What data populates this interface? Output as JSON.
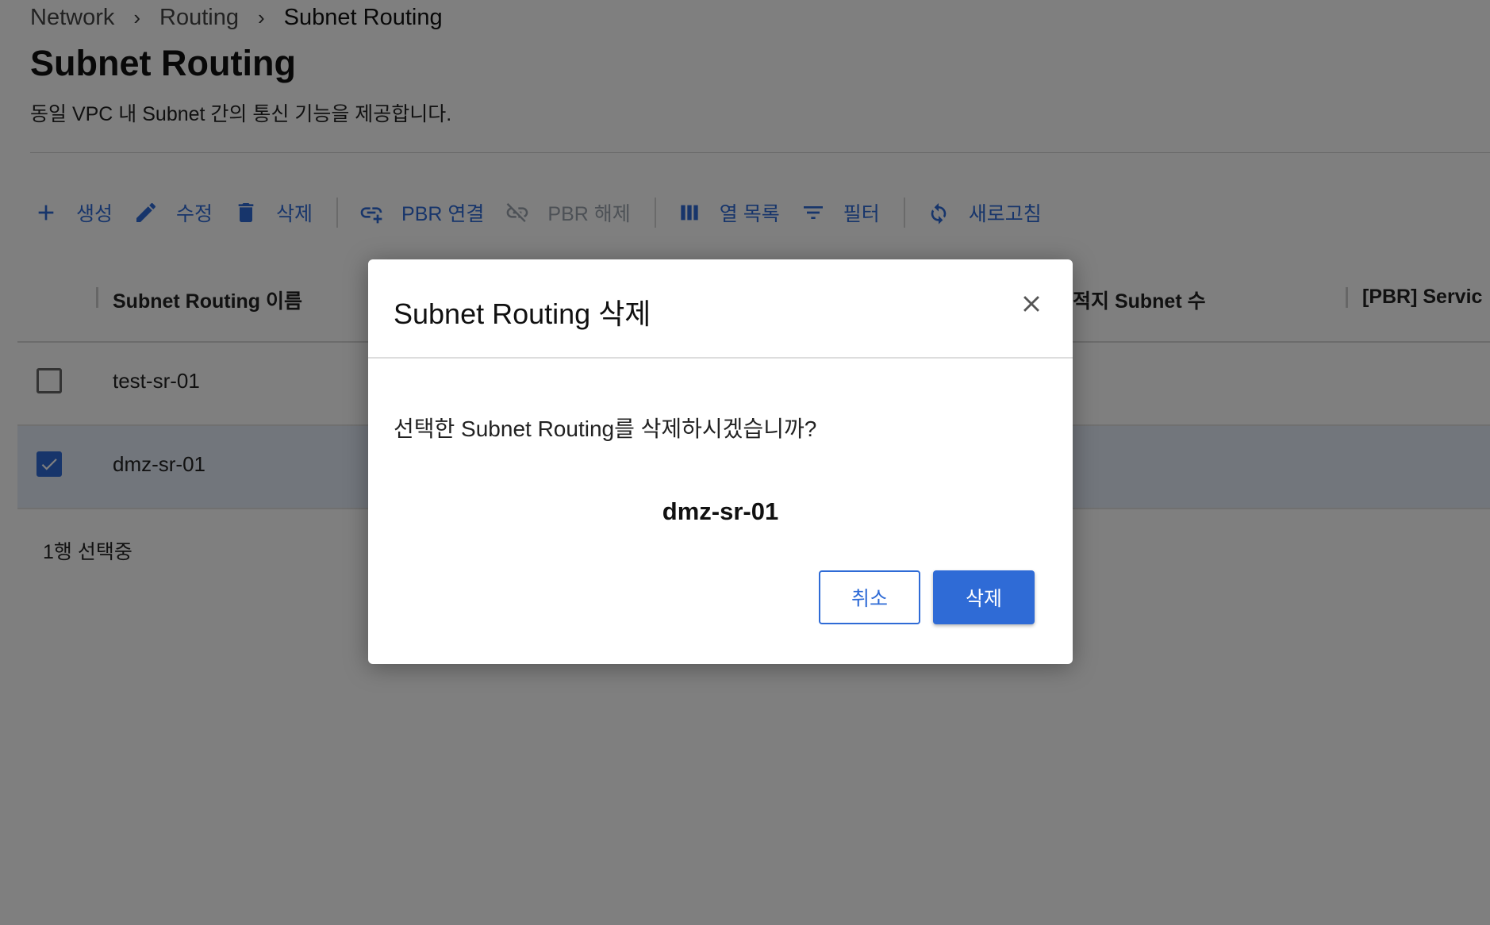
{
  "breadcrumb": [
    {
      "label": "Network"
    },
    {
      "label": "Routing"
    },
    {
      "label": "Subnet Routing"
    }
  ],
  "page": {
    "title": "Subnet Routing",
    "description": "동일 VPC 내 Subnet 간의 통신 기능을 제공합니다."
  },
  "toolbar": {
    "create": "생성",
    "edit": "수정",
    "delete": "삭제",
    "pbr_connect": "PBR 연결",
    "pbr_disconnect": "PBR 해제",
    "columns": "열 목록",
    "filter": "필터",
    "refresh": "새로고침"
  },
  "table": {
    "headers": [
      "Subnet Routing 이름",
      "적지 Subnet 수",
      "[PBR] Servic"
    ],
    "rows": [
      {
        "name": "test-sr-01",
        "checked": false
      },
      {
        "name": "dmz-sr-01",
        "checked": true
      }
    ],
    "selection_text": "1행 선택중"
  },
  "modal": {
    "title": "Subnet Routing 삭제",
    "message": "선택한 Subnet Routing를 삭제하시겠습니까?",
    "target": "dmz-sr-01",
    "cancel_label": "취소",
    "delete_label": "삭제"
  },
  "colors": {
    "accent": "#2f6bd6",
    "disabled": "#9aa3ad",
    "selected_row": "#e4ecf8",
    "overlay": "rgba(0,0,0,0.5)"
  },
  "icons": [
    "plus-icon",
    "pencil-icon",
    "trash-icon",
    "link-add-icon",
    "link-off-icon",
    "columns-icon",
    "filter-icon",
    "refresh-icon",
    "close-icon",
    "check-icon"
  ]
}
